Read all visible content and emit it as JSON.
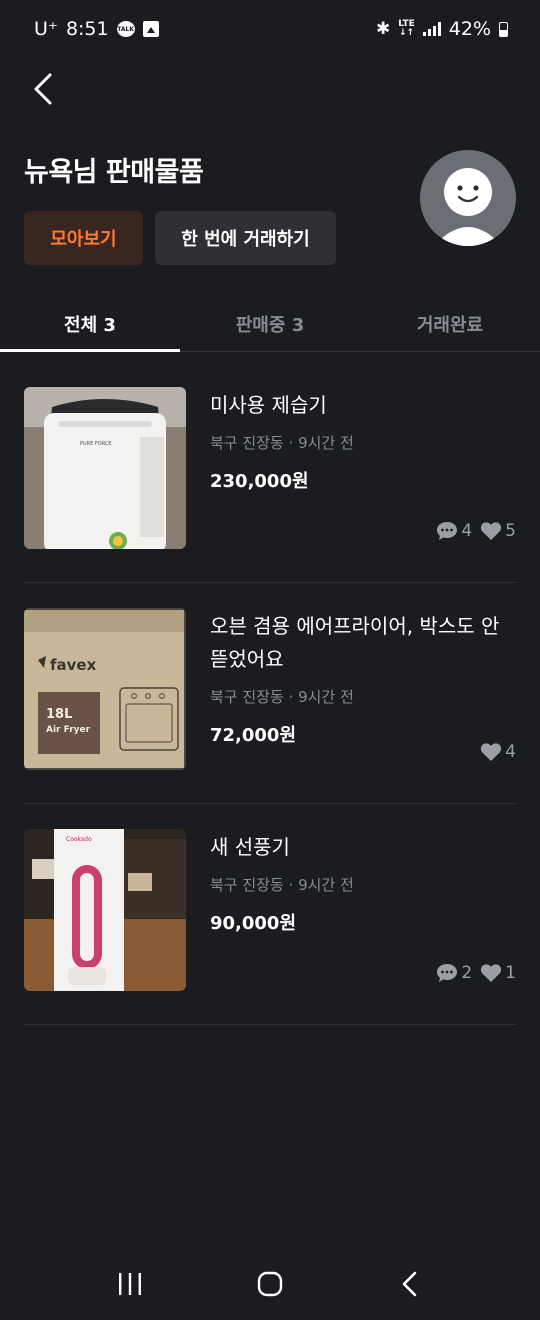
{
  "status_bar": {
    "carrier": "U⁺",
    "time": "8:51",
    "talk_icon_label": "TALK",
    "network": "LTE",
    "battery": "42%"
  },
  "header": {
    "title": "뉴욕님 판매물품",
    "collect_button": "모아보기",
    "trade_button": "한 번에 거래하기"
  },
  "tabs": [
    {
      "label": "전체 3",
      "active": true
    },
    {
      "label": "판매중 3",
      "active": false
    },
    {
      "label": "거래완료",
      "active": false
    }
  ],
  "items": [
    {
      "title": "미사용 제습기",
      "meta": "북구 진장동 · 9시간 전",
      "price": "230,000원",
      "chats": "4",
      "likes": "5",
      "thumb_brand": "PURE FORCE"
    },
    {
      "title": "오븐 겸용 에어프라이어, 박스도 안 뜯었어요",
      "meta": "북구 진장동 · 9시간 전",
      "price": "72,000원",
      "chats": "",
      "likes": "4",
      "thumb_brand": "favex",
      "thumb_size": "18L",
      "thumb_product": "Air Fryer"
    },
    {
      "title": "새 선풍기",
      "meta": "북구 진장동 · 9시간 전",
      "price": "90,000원",
      "chats": "2",
      "likes": "1",
      "thumb_brand": "Cooksdo"
    }
  ],
  "colors": {
    "background": "#1b1c1f",
    "accent": "#ff7a2e"
  }
}
